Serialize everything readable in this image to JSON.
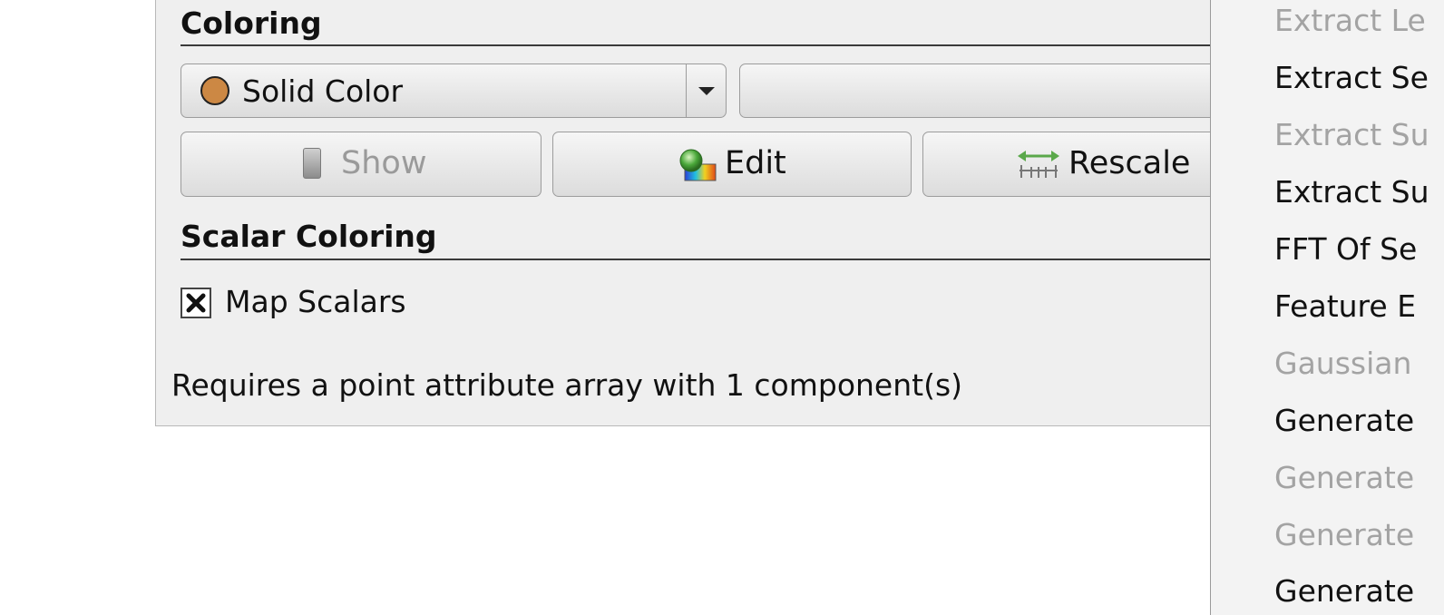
{
  "coloring": {
    "section_title": "Coloring",
    "color_mode": "Solid Color",
    "swatch_color": "#cc8844",
    "buttons": {
      "show": "Show",
      "edit": "Edit",
      "rescale": "Rescale"
    }
  },
  "scalar_coloring": {
    "section_title": "Scalar Coloring",
    "map_scalars_label": "Map Scalars",
    "map_scalars_checked": true
  },
  "requires_text": "Requires a point attribute array with 1 component(s)",
  "menu": {
    "items": [
      {
        "label": "Extract Le",
        "enabled": false
      },
      {
        "label": "Extract Se",
        "enabled": true
      },
      {
        "label": "Extract Su",
        "enabled": false
      },
      {
        "label": "Extract Su",
        "enabled": true
      },
      {
        "label": "FFT Of Se",
        "enabled": true
      },
      {
        "label": "Feature E",
        "enabled": true
      },
      {
        "label": "Gaussian",
        "enabled": false
      },
      {
        "label": "Generate",
        "enabled": true
      },
      {
        "label": "Generate",
        "enabled": false
      },
      {
        "label": "Generate",
        "enabled": false
      },
      {
        "label": "Generate",
        "enabled": true
      }
    ]
  }
}
